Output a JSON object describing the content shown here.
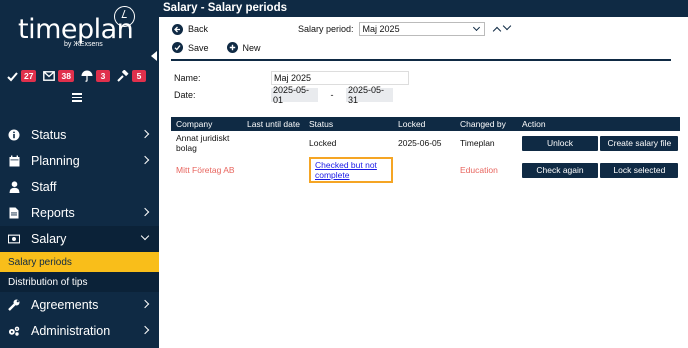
{
  "app": {
    "logo_text": "timeplan",
    "logo_by": "by ЖExsens",
    "page_title": "Salary - Salary periods"
  },
  "badges": [
    {
      "icon": "check-icon",
      "count": "27"
    },
    {
      "icon": "mail-icon",
      "count": "38"
    },
    {
      "icon": "umbrella-icon",
      "count": "3"
    },
    {
      "icon": "hammer-icon",
      "count": "5"
    }
  ],
  "sidebar": {
    "items": [
      {
        "label": "Status",
        "icon": "info-icon"
      },
      {
        "label": "Planning",
        "icon": "calendar-icon"
      },
      {
        "label": "Staff",
        "icon": "person-icon"
      },
      {
        "label": "Reports",
        "icon": "document-icon"
      },
      {
        "label": "Salary",
        "icon": "money-icon"
      },
      {
        "label": "Agreements",
        "icon": "wrench-icon"
      },
      {
        "label": "Administration",
        "icon": "gears-icon"
      }
    ],
    "sub_items": [
      {
        "label": "Salary periods"
      },
      {
        "label": "Distribution of tips"
      }
    ]
  },
  "toolbar": {
    "back_label": "Back",
    "period_label": "Salary period:",
    "period_value": "Maj 2025",
    "save_label": "Save",
    "new_label": "New"
  },
  "form": {
    "name_label": "Name:",
    "name_value": "Maj 2025",
    "date_label": "Date:",
    "date_from": "2025-05-01",
    "date_sep": "-",
    "date_to": "2025-05-31"
  },
  "table": {
    "headers": [
      "Company",
      "Last until date",
      "Status",
      "Locked",
      "Changed by",
      "Action"
    ],
    "rows": [
      {
        "company": "Annat juridiskt bolag",
        "last_until": "",
        "status": "Locked",
        "locked": "2025-06-05",
        "changed_by": "Timeplan",
        "action1": "Unlock",
        "action2": "Create salary file"
      },
      {
        "company": "Mitt Företag AB",
        "last_until": "",
        "status": "Checked but not complete",
        "locked": "",
        "changed_by": "Education",
        "action1": "Check again",
        "action2": "Lock selected"
      }
    ]
  },
  "colors": {
    "navy": "#0f2a44",
    "badge_red": "#e0304c",
    "active_yellow": "#f9be1a",
    "highlight_orange": "#f5a524",
    "warning_text": "#e8655e"
  }
}
